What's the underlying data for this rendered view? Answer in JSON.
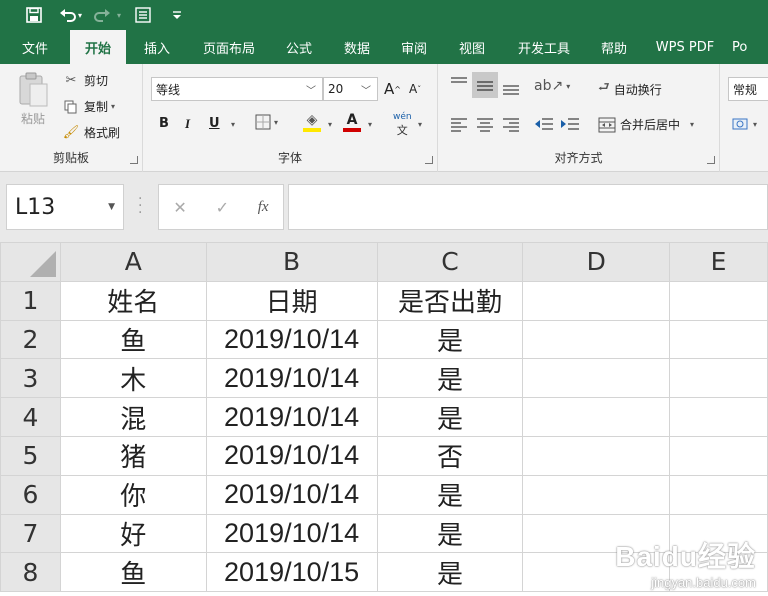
{
  "quick_access": {
    "save_icon": "save-icon",
    "undo_icon": "undo-icon",
    "redo_icon": "redo-icon",
    "form_icon": "form-icon",
    "customize_icon": "customize-icon"
  },
  "tabs": [
    "文件",
    "开始",
    "插入",
    "页面布局",
    "公式",
    "数据",
    "审阅",
    "视图",
    "开发工具",
    "帮助",
    "WPS PDF",
    "Po"
  ],
  "active_tab": "开始",
  "ribbon": {
    "clipboard": {
      "paste": "粘贴",
      "cut": "剪切",
      "copy": "复制",
      "format_painter": "格式刷",
      "label": "剪贴板"
    },
    "font": {
      "font_name": "等线",
      "font_size": "20",
      "bold": "B",
      "italic": "I",
      "underline": "U",
      "grow": "A",
      "shrink": "A",
      "font_color_letter": "A",
      "phonetic": "wén",
      "label": "字体"
    },
    "alignment": {
      "wrap_text": "自动换行",
      "merge_center": "合并后居中",
      "label": "对齐方式"
    },
    "number": {
      "format": "常规"
    }
  },
  "formula_bar": {
    "name_box": "L13",
    "cancel": "✕",
    "enter": "✓",
    "fx": "fx",
    "formula": ""
  },
  "columns": [
    "A",
    "B",
    "C",
    "D",
    "E"
  ],
  "rows": [
    {
      "n": "1",
      "a": "姓名",
      "b": "日期",
      "c": "是否出勤"
    },
    {
      "n": "2",
      "a": "鱼",
      "b": "2019/10/14",
      "c": "是"
    },
    {
      "n": "3",
      "a": "木",
      "b": "2019/10/14",
      "c": "是"
    },
    {
      "n": "4",
      "a": "混",
      "b": "2019/10/14",
      "c": "是"
    },
    {
      "n": "5",
      "a": "猪",
      "b": "2019/10/14",
      "c": "否"
    },
    {
      "n": "6",
      "a": "你",
      "b": "2019/10/14",
      "c": "是"
    },
    {
      "n": "7",
      "a": "好",
      "b": "2019/10/14",
      "c": "是"
    },
    {
      "n": "8",
      "a": "鱼",
      "b": "2019/10/15",
      "c": "是"
    }
  ],
  "watermark": {
    "main": "Baidu经验",
    "sub": "jingyan.baidu.com"
  },
  "colors": {
    "brand": "#217346",
    "header_bg": "#e6e6e6",
    "ribbon_bg": "#f3f3f3",
    "font_color_bar": "#d00000",
    "highlight_bar": "#ffe800"
  }
}
